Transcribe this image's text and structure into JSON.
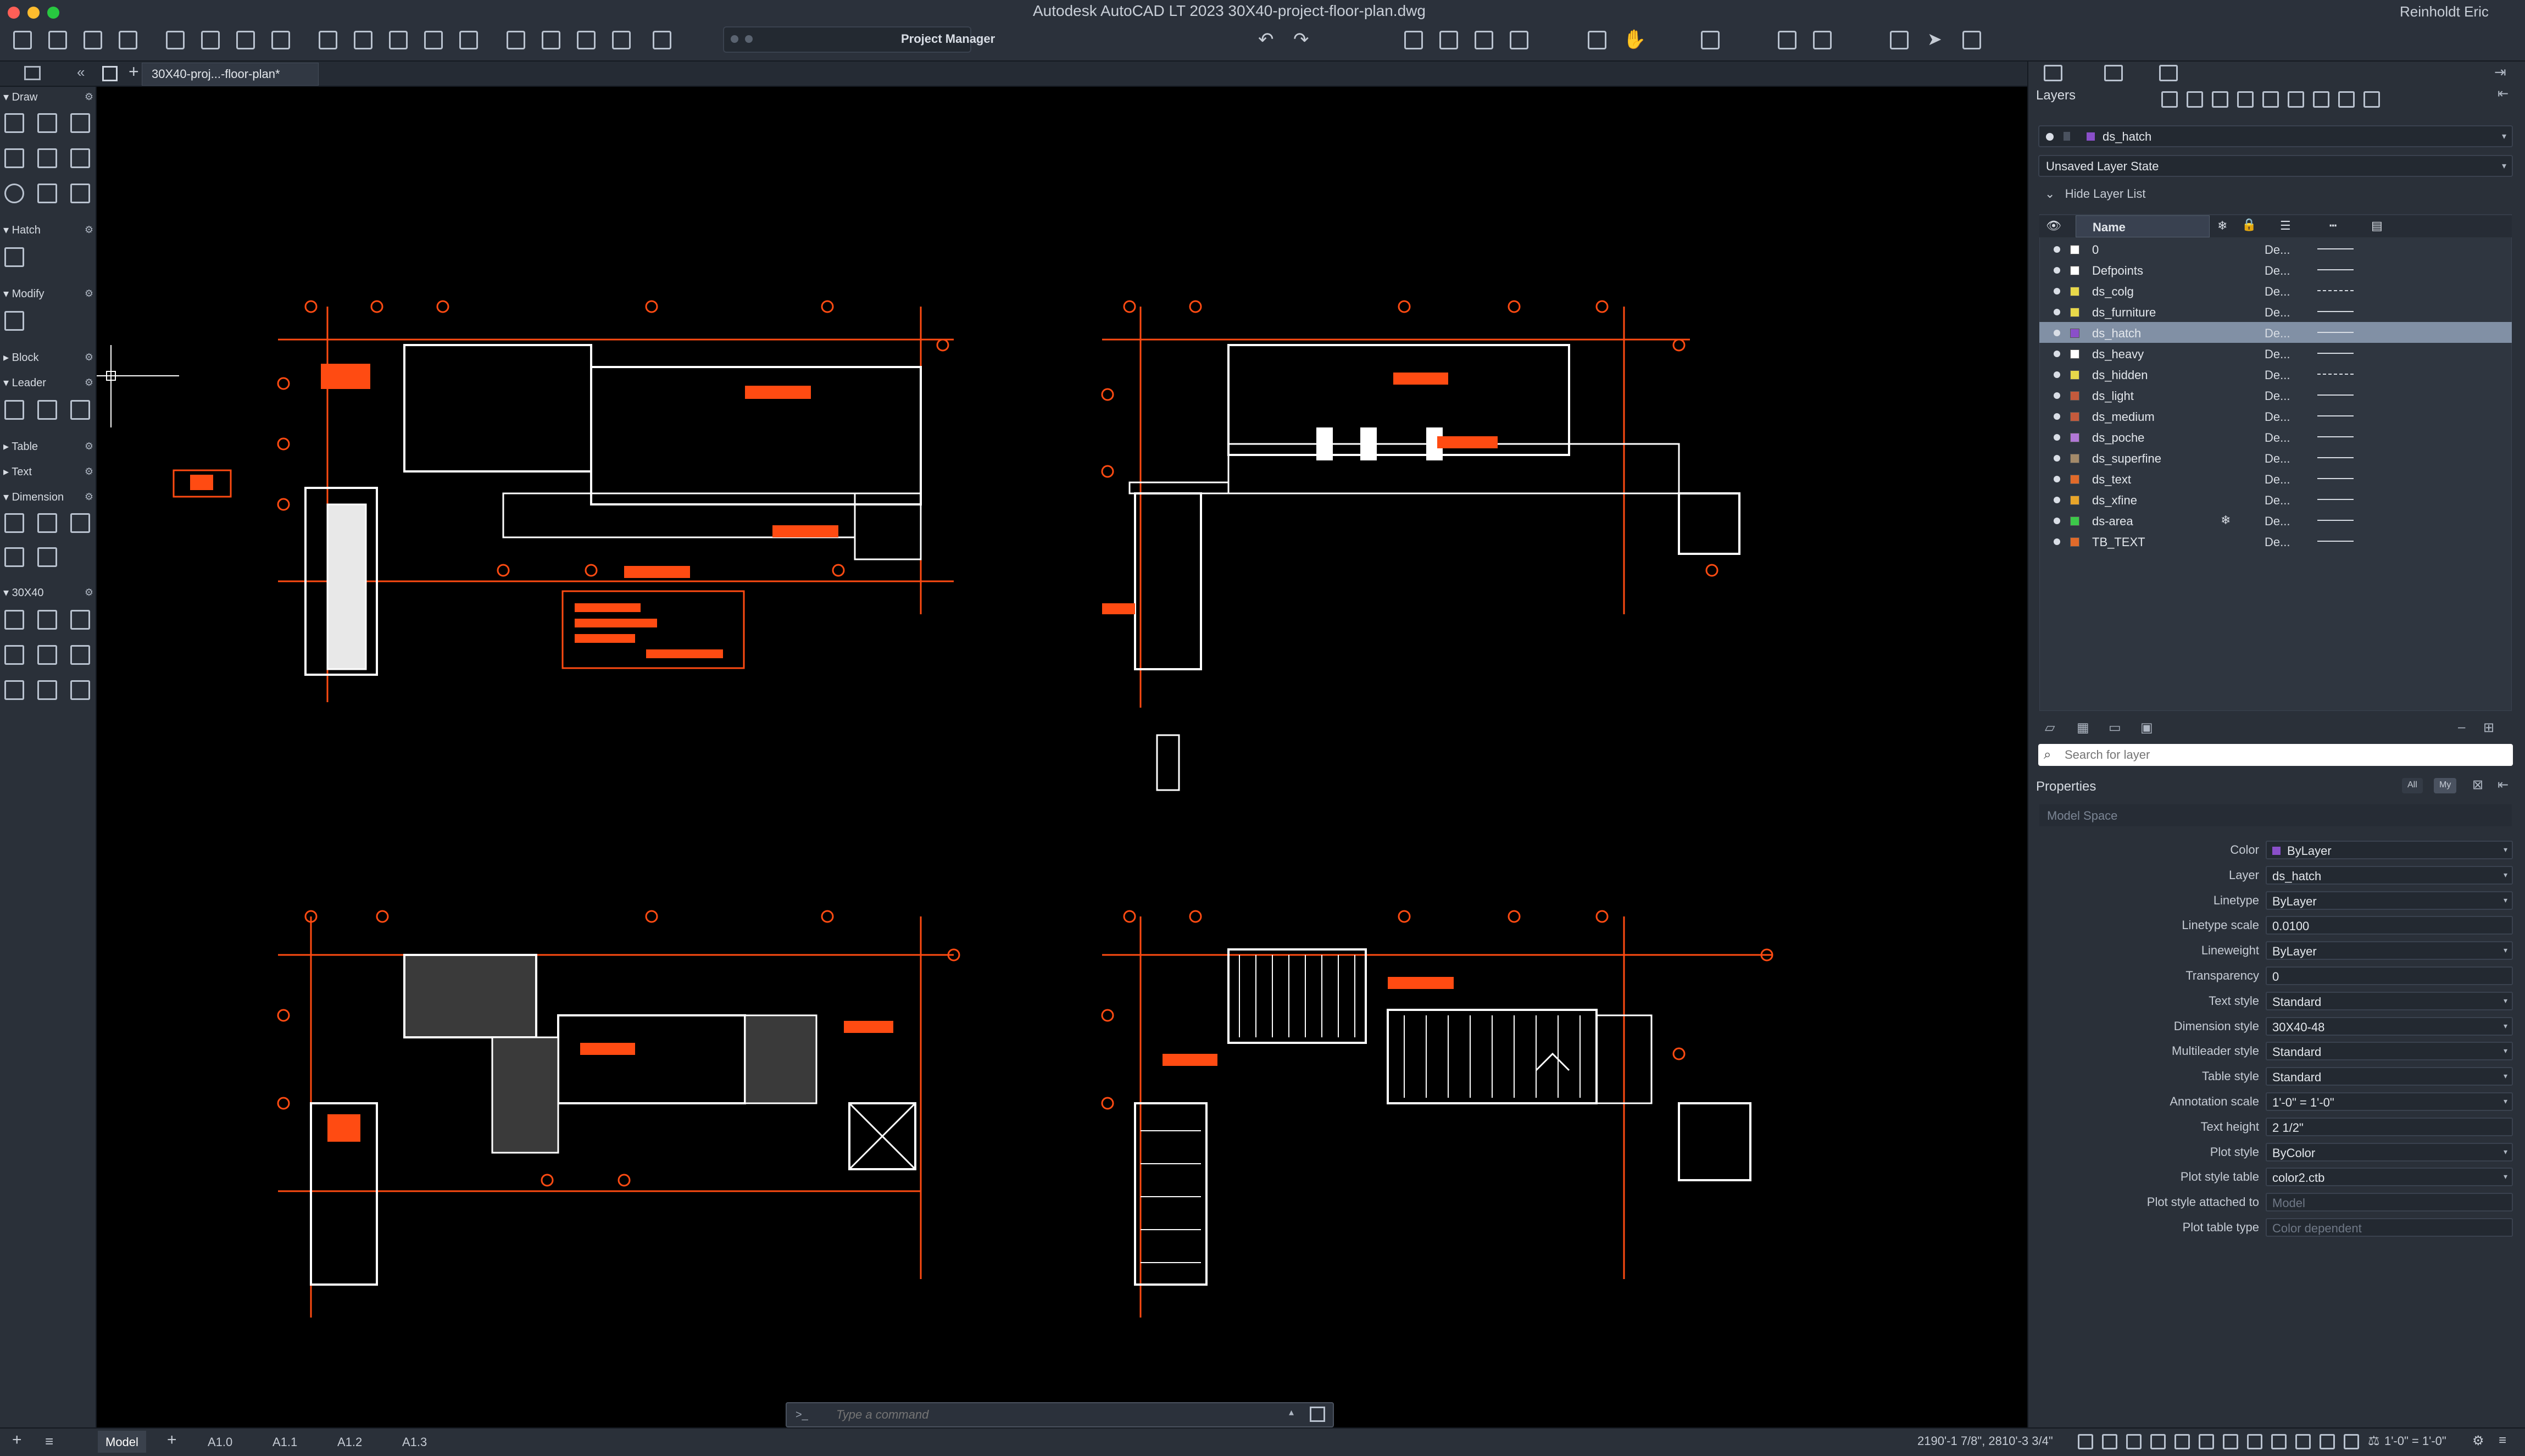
{
  "titlebar": {
    "app_title": "Autodesk AutoCAD LT 2023   30X40-project-floor-plan.dwg",
    "project_manager": "Project Manager",
    "user": "Reinholdt Eric"
  },
  "tabs": {
    "document_tab": "30X40-proj...-floor-plan*"
  },
  "palette": {
    "sections": [
      "Draw",
      "Hatch",
      "Modify",
      "Block",
      "Leader",
      "Table",
      "Text",
      "Dimension",
      "30X40"
    ]
  },
  "command": {
    "prompt": ">_",
    "placeholder": "Type a command"
  },
  "status": {
    "layout_tabs": [
      "Model",
      "A1.0",
      "A1.1",
      "A1.2",
      "A1.3"
    ],
    "coords": "2190'-1 7/8\", 2810'-3 3/4\"",
    "scale": "1'-0\" = 1'-0\""
  },
  "layers_panel": {
    "title": "Layers",
    "current_layer": "ds_hatch",
    "layer_state": "Unsaved Layer State",
    "hide_list": "Hide Layer List",
    "name_header": "Name",
    "search_placeholder": "Search for layer",
    "layers": [
      {
        "name": "0",
        "desc": "De...",
        "color": "#ffffff",
        "linetype": "solid"
      },
      {
        "name": "Defpoints",
        "desc": "De...",
        "color": "#ffffff",
        "linetype": "solid"
      },
      {
        "name": "ds_colg",
        "desc": "De...",
        "color": "#e8d84a",
        "linetype": "dashdot"
      },
      {
        "name": "ds_furniture",
        "desc": "De...",
        "color": "#e8d84a",
        "linetype": "solid"
      },
      {
        "name": "ds_hatch",
        "desc": "De...",
        "color": "#8a4fc9",
        "linetype": "solid",
        "selected": true
      },
      {
        "name": "ds_heavy",
        "desc": "De...",
        "color": "#ffffff",
        "linetype": "solid"
      },
      {
        "name": "ds_hidden",
        "desc": "De...",
        "color": "#e8d84a",
        "linetype": "dashed"
      },
      {
        "name": "ds_light",
        "desc": "De...",
        "color": "#c45a3c",
        "linetype": "solid"
      },
      {
        "name": "ds_medium",
        "desc": "De...",
        "color": "#c45a3c",
        "linetype": "solid"
      },
      {
        "name": "ds_poche",
        "desc": "De...",
        "color": "#b178d6",
        "linetype": "solid"
      },
      {
        "name": "ds_superfine",
        "desc": "De...",
        "color": "#a38a6a",
        "linetype": "solid"
      },
      {
        "name": "ds_text",
        "desc": "De...",
        "color": "#e06a2a",
        "linetype": "solid"
      },
      {
        "name": "ds_xfine",
        "desc": "De...",
        "color": "#e8a52a",
        "linetype": "solid"
      },
      {
        "name": "ds-area",
        "desc": "De...",
        "color": "#3cc94a",
        "linetype": "solid",
        "frozen": true
      },
      {
        "name": "TB_TEXT",
        "desc": "De...",
        "color": "#e06a2a",
        "linetype": "solid"
      }
    ]
  },
  "properties": {
    "title": "Properties",
    "filter_all": "All",
    "filter_my": "My",
    "context": "Model Space",
    "rows": [
      {
        "label": "Color",
        "value": "ByLayer",
        "swatch": "#8a4fc9",
        "dropdown": true
      },
      {
        "label": "Layer",
        "value": "ds_hatch",
        "dropdown": true
      },
      {
        "label": "Linetype",
        "value": "ByLayer",
        "dropdown": true
      },
      {
        "label": "Linetype scale",
        "value": "0.0100"
      },
      {
        "label": "Lineweight",
        "value": "ByLayer",
        "dropdown": true
      },
      {
        "label": "Transparency",
        "value": "0"
      },
      {
        "label": "Text style",
        "value": "Standard",
        "dropdown": true
      },
      {
        "label": "Dimension style",
        "value": "30X40-48",
        "dropdown": true
      },
      {
        "label": "Multileader style",
        "value": "Standard",
        "dropdown": true
      },
      {
        "label": "Table style",
        "value": "Standard",
        "dropdown": true
      },
      {
        "label": "Annotation scale",
        "value": "1'-0\" = 1'-0\"",
        "dropdown": true
      },
      {
        "label": "Text height",
        "value": "2 1/2\""
      },
      {
        "label": "Plot style",
        "value": "ByColor",
        "dropdown": true
      },
      {
        "label": "Plot style table",
        "value": "color2.ctb",
        "dropdown": true
      },
      {
        "label": "Plot style attached to",
        "value": "Model",
        "disabled": true
      },
      {
        "label": "Plot table type",
        "value": "Color dependent",
        "disabled": true
      }
    ]
  }
}
